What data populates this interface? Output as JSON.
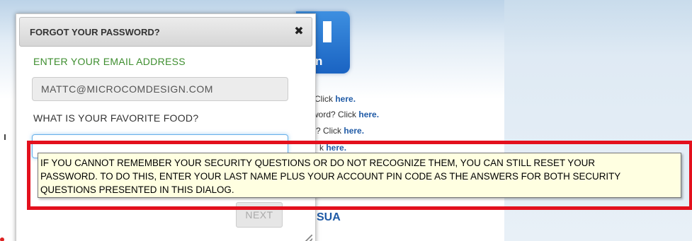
{
  "background": {
    "logo_letter": "n",
    "links": [
      {
        "prefix": "Click",
        "link": "here."
      },
      {
        "prefix": "word? Click",
        "link": "here."
      },
      {
        "prefix": "? Click",
        "link": "here."
      },
      {
        "prefix": "k",
        "link": "here."
      }
    ],
    "sua_text": "SUA"
  },
  "dialog": {
    "title": "FORGOT YOUR PASSWORD?",
    "close_symbol": "✖",
    "email_label": "ENTER YOUR EMAIL ADDRESS",
    "email_value": "MATTC@MICROCOMDESIGN.COM",
    "question_label": "WHAT IS YOUR FAVORITE FOOD?",
    "answer_value": "",
    "next_label": "NEXT"
  },
  "tooltip": {
    "lines": [
      "IF YOU CANNOT REMEMBER YOUR SECURITY QUESTIONS OR DO NOT RECOGNIZE THEM, YOU CAN STILL RESET YOUR",
      "PASSWORD. TO DO THIS, ENTER YOUR LAST NAME PLUS YOUR ACCOUNT PIN CODE AS THE ANSWERS FOR BOTH SECURITY",
      "QUESTIONS PRESENTED IN THIS DIALOG."
    ]
  },
  "colors": {
    "highlight_box": "#e3101d",
    "tooltip_bg": "#ffffe1",
    "email_label": "#3e8e2f",
    "link": "#1f5aa6"
  }
}
